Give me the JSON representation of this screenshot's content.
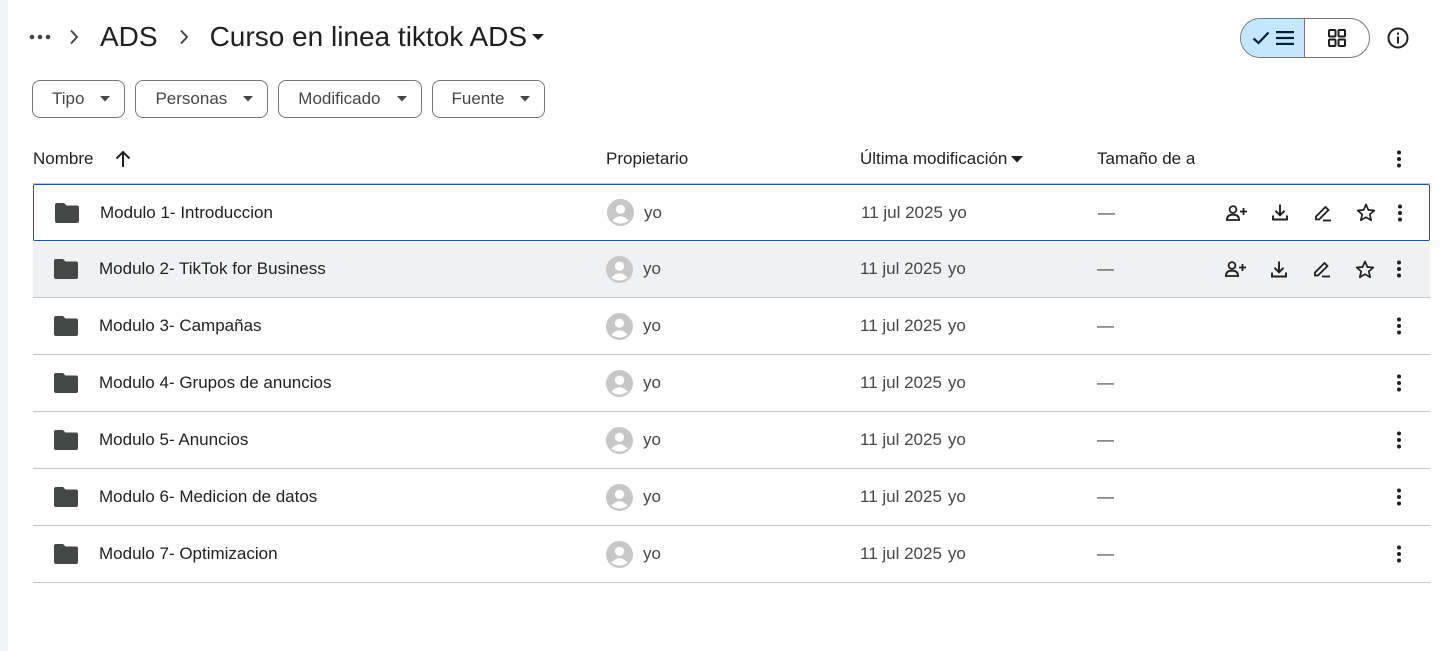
{
  "header": {
    "more_label": "…",
    "crumbs": [
      "ADS"
    ],
    "current": "Curso en linea tiktok ADS"
  },
  "filters": [
    "Tipo",
    "Personas",
    "Modificado",
    "Fuente"
  ],
  "table": {
    "columns": {
      "name": "Nombre",
      "owner": "Propietario",
      "modified": "Última modificación",
      "size": "Tamaño de a"
    },
    "rows": [
      {
        "name": "Modulo 1- Introduccion",
        "owner": "yo",
        "date": "11 jul 2025",
        "by": "yo",
        "size": "—"
      },
      {
        "name": "Modulo 2- TikTok for Business",
        "owner": "yo",
        "date": "11 jul 2025",
        "by": "yo",
        "size": "—"
      },
      {
        "name": "Modulo 3- Campañas",
        "owner": "yo",
        "date": "11 jul 2025",
        "by": "yo",
        "size": "—"
      },
      {
        "name": "Modulo 4- Grupos de anuncios",
        "owner": "yo",
        "date": "11 jul 2025",
        "by": "yo",
        "size": "—"
      },
      {
        "name": "Modulo 5- Anuncios",
        "owner": "yo",
        "date": "11 jul 2025",
        "by": "yo",
        "size": "—"
      },
      {
        "name": "Modulo 6- Medicion de datos",
        "owner": "yo",
        "date": "11 jul 2025",
        "by": "yo",
        "size": "—"
      },
      {
        "name": "Modulo 7- Optimizacion",
        "owner": "yo",
        "date": "11 jul 2025",
        "by": "yo",
        "size": "—"
      }
    ]
  },
  "colors": {
    "accent": "#0b57d0",
    "toggle_active": "#c2e7ff",
    "row_hover": "#eff1f2",
    "divider": "#c4c7c5"
  },
  "icons": {
    "folder": "folder-icon",
    "avatar": "account-circle-icon",
    "share": "person-add-icon",
    "download": "download-icon",
    "rename": "edit-icon",
    "star": "star-icon",
    "more": "more-vert-icon"
  }
}
